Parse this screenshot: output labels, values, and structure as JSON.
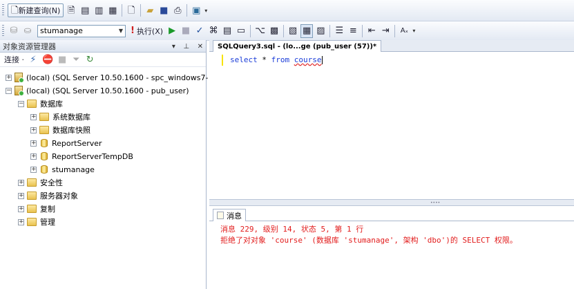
{
  "toolbar1": {
    "new_query_label": "新建查询(N)"
  },
  "toolbar2": {
    "database": "stumanage",
    "execute_label": "执行(X)"
  },
  "object_explorer": {
    "title": "对象资源管理器",
    "connect_label": "连接 ·",
    "nodes": {
      "server1": "(local) (SQL Server 10.50.1600 - spc_windows7-",
      "server2": "(local) (SQL Server 10.50.1600 - pub_user)",
      "databases": "数据库",
      "system_db": "系统数据库",
      "db_snapshots": "数据库快照",
      "reportserver": "ReportServer",
      "reportserver_temp": "ReportServerTempDB",
      "stumanage": "stumanage",
      "security": "安全性",
      "server_objects": "服务器对象",
      "replication": "复制",
      "management": "管理"
    }
  },
  "editor": {
    "tab_title": "SQLQuery3.sql - (lo...ge (pub_user (57))*",
    "sql": {
      "select": "select",
      "star": " * ",
      "from": "from",
      "space": " ",
      "table": "course"
    }
  },
  "results": {
    "tab_label": "消息",
    "line1": "消息 229, 级别 14, 状态 5, 第 1 行",
    "line2": "拒绝了对对象 'course' (数据库 'stumanage', 架构 'dbo')的 SELECT 权限。"
  }
}
